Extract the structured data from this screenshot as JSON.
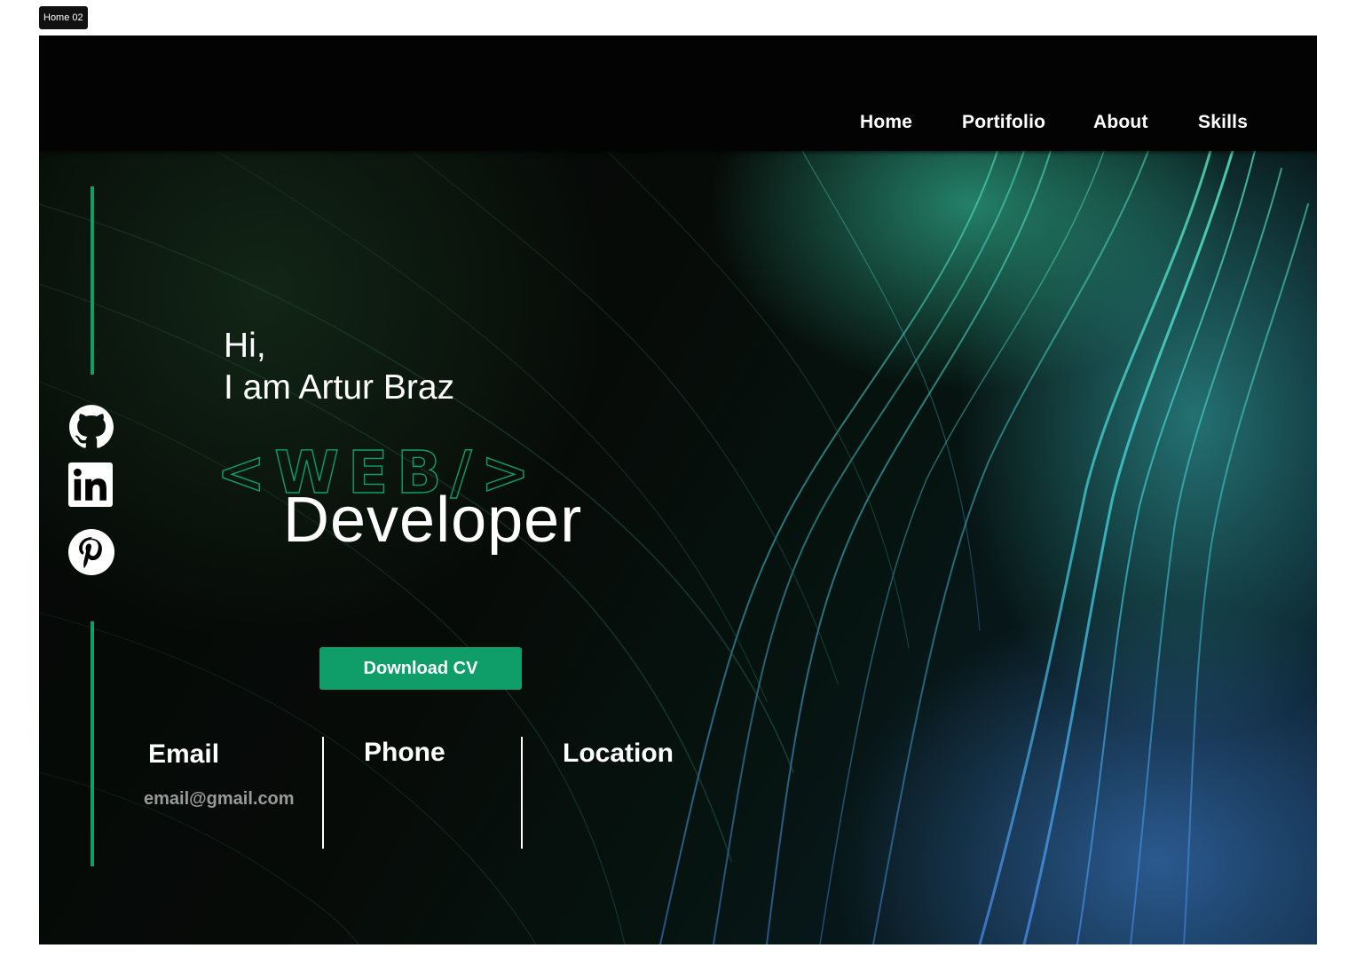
{
  "frame": {
    "label": "Home 02"
  },
  "nav": {
    "items": [
      {
        "label": "Home"
      },
      {
        "label": "Portifolio"
      },
      {
        "label": "About"
      },
      {
        "label": "Skills"
      }
    ]
  },
  "hero": {
    "greeting": "Hi,",
    "intro": "I am Artur Braz",
    "outline_word": "<WEB/>",
    "role": "Developer",
    "cta_label": "Download CV"
  },
  "social": [
    {
      "icon": "github-icon"
    },
    {
      "icon": "linkedin-icon"
    },
    {
      "icon": "pinterest-icon"
    }
  ],
  "contact": {
    "email_title": "Email",
    "email_value": "email@gmail.com",
    "phone_title": "Phone",
    "location_title": "Location"
  },
  "colors": {
    "accent": "#0f9e6a",
    "background": "#000000",
    "text": "#ffffff",
    "muted": "#9a9a9a"
  }
}
